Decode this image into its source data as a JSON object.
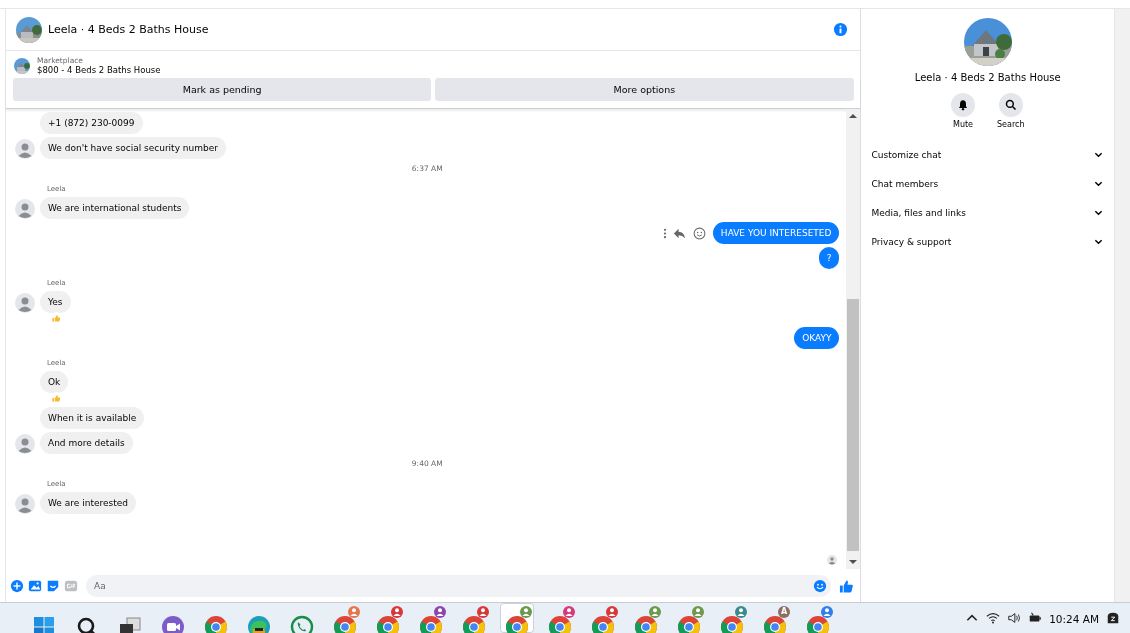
{
  "chat": {
    "title": "Leela · 4 Beds 2 Baths House",
    "listing": {
      "label": "Marketplace",
      "text": "$800 - 4 Beds 2 Baths House"
    },
    "actions": [
      "Mark as pending",
      "More options"
    ],
    "messages": [
      {
        "kind": "in",
        "text": "+1 (872) 230-0099",
        "avatar": false,
        "liked": false
      },
      {
        "kind": "in",
        "text": "We don't have social security number",
        "avatar": true,
        "liked": false
      },
      {
        "kind": "time",
        "text": "6:37 AM"
      },
      {
        "kind": "sender",
        "text": "Leela"
      },
      {
        "kind": "in",
        "text": "We are international students",
        "avatar": true,
        "liked": false
      },
      {
        "kind": "out",
        "text": "HAVE YOU INTERESETED",
        "hovered": true
      },
      {
        "kind": "out",
        "text": "?",
        "hovered": false
      },
      {
        "kind": "sender",
        "text": "Leela"
      },
      {
        "kind": "in",
        "text": "Yes",
        "avatar": true,
        "liked": true
      },
      {
        "kind": "out",
        "text": "OKAYY",
        "hovered": false
      },
      {
        "kind": "sender",
        "text": "Leela"
      },
      {
        "kind": "in",
        "text": "Ok",
        "avatar": false,
        "liked": true
      },
      {
        "kind": "in",
        "text": "When it is available",
        "avatar": false,
        "liked": false
      },
      {
        "kind": "in",
        "text": "And more details",
        "avatar": true,
        "liked": false
      },
      {
        "kind": "time",
        "text": "9:40 AM"
      },
      {
        "kind": "sender",
        "text": "Leela"
      },
      {
        "kind": "in",
        "text": "We are interested",
        "avatar": true,
        "liked": false
      }
    ],
    "composer": {
      "placeholder": "Aa"
    }
  },
  "details": {
    "title": "Leela · 4 Beds 2 Baths House",
    "buttons": [
      {
        "kind": "mute",
        "label": "Mute"
      },
      {
        "kind": "search",
        "label": "Search"
      }
    ],
    "sections": [
      {
        "label": "Customize chat",
        "expanded": false
      },
      {
        "label": "Chat members",
        "expanded": false
      },
      {
        "label": "Media, files and links",
        "expanded": false
      },
      {
        "label": "Privacy & support",
        "expanded": false
      }
    ]
  },
  "taskbar": {
    "apps": [
      {
        "kind": "windows",
        "selected": false
      },
      {
        "kind": "search",
        "selected": false
      },
      {
        "kind": "taskview",
        "selected": false
      },
      {
        "kind": "meet",
        "selected": false
      },
      {
        "kind": "chrome",
        "selected": false
      },
      {
        "kind": "edge",
        "selected": false
      },
      {
        "kind": "whatsapp",
        "selected": false
      },
      {
        "kind": "profile",
        "color": "#e8744a",
        "selected": false
      },
      {
        "kind": "profile",
        "color": "#d93838",
        "selected": false
      },
      {
        "kind": "profile",
        "color": "#8e44ad",
        "selected": false
      },
      {
        "kind": "profile",
        "color": "#d93838",
        "selected": false
      },
      {
        "kind": "profile",
        "color": "#6a9a4a",
        "selected": true
      },
      {
        "kind": "profile",
        "color": "#d63a7a",
        "selected": false
      },
      {
        "kind": "profile",
        "color": "#d93838",
        "selected": false
      },
      {
        "kind": "profile",
        "color": "#6a9a4a",
        "selected": false
      },
      {
        "kind": "profile",
        "color": "#6a9a4a",
        "selected": false
      },
      {
        "kind": "profile",
        "color": "#3a8a8a",
        "selected": false
      },
      {
        "kind": "letter",
        "color": "#8d6e63",
        "letter": "A",
        "selected": false
      },
      {
        "kind": "profile",
        "color": "#2f80ed",
        "selected": false
      }
    ],
    "time": "10:24 AM"
  }
}
